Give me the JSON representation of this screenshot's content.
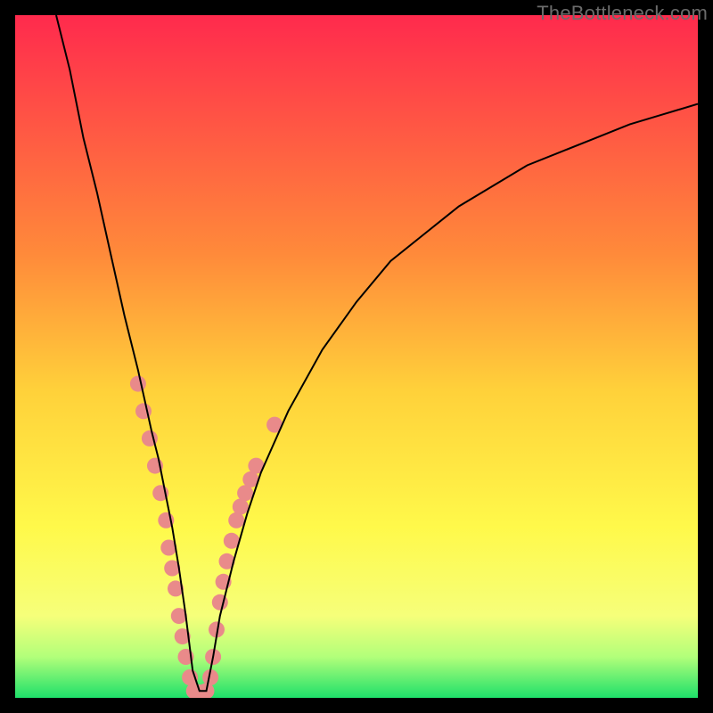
{
  "watermark": "TheBottleneck.com",
  "chart_data": {
    "type": "line",
    "title": "",
    "xlabel": "",
    "ylabel": "",
    "xlim": [
      0,
      100
    ],
    "ylim": [
      0,
      100
    ],
    "grid": false,
    "legend": false,
    "background_gradient": {
      "stops": [
        {
          "offset": 0.0,
          "color": "#ff2a4d"
        },
        {
          "offset": 0.35,
          "color": "#ff8a3a"
        },
        {
          "offset": 0.55,
          "color": "#ffd13a"
        },
        {
          "offset": 0.75,
          "color": "#fff94a"
        },
        {
          "offset": 0.88,
          "color": "#f6ff7a"
        },
        {
          "offset": 0.94,
          "color": "#b2ff7a"
        },
        {
          "offset": 1.0,
          "color": "#1ee06a"
        }
      ]
    },
    "series": [
      {
        "name": "curve",
        "color": "#000000",
        "stroke_width": 2,
        "x": [
          6,
          8,
          10,
          12,
          14,
          16,
          18,
          20,
          21,
          22,
          23,
          24,
          25,
          26,
          27,
          28,
          29,
          30,
          32,
          34,
          36,
          40,
          45,
          50,
          55,
          60,
          65,
          70,
          75,
          80,
          85,
          90,
          95,
          100
        ],
        "y": [
          100,
          92,
          82,
          74,
          65,
          56,
          48,
          39,
          35,
          30,
          25,
          19,
          12,
          4,
          1,
          1,
          6,
          12,
          20,
          27,
          33,
          42,
          51,
          58,
          64,
          68,
          72,
          75,
          78,
          80,
          82,
          84,
          85.5,
          87
        ]
      }
    ],
    "markers": {
      "name": "highlight-points",
      "color": "#e98a8a",
      "radius": 9,
      "points": [
        {
          "x": 18.0,
          "y": 46
        },
        {
          "x": 18.8,
          "y": 42
        },
        {
          "x": 19.7,
          "y": 38
        },
        {
          "x": 20.5,
          "y": 34
        },
        {
          "x": 21.3,
          "y": 30
        },
        {
          "x": 22.1,
          "y": 26
        },
        {
          "x": 22.5,
          "y": 22
        },
        {
          "x": 23.0,
          "y": 19
        },
        {
          "x": 23.5,
          "y": 16
        },
        {
          "x": 24.0,
          "y": 12
        },
        {
          "x": 24.5,
          "y": 9
        },
        {
          "x": 25.0,
          "y": 6
        },
        {
          "x": 25.6,
          "y": 3
        },
        {
          "x": 26.2,
          "y": 1
        },
        {
          "x": 26.8,
          "y": 0.8
        },
        {
          "x": 27.4,
          "y": 0.8
        },
        {
          "x": 28.0,
          "y": 1
        },
        {
          "x": 28.6,
          "y": 3
        },
        {
          "x": 29.0,
          "y": 6
        },
        {
          "x": 29.5,
          "y": 10
        },
        {
          "x": 30.0,
          "y": 14
        },
        {
          "x": 30.5,
          "y": 17
        },
        {
          "x": 31.0,
          "y": 20
        },
        {
          "x": 31.7,
          "y": 23
        },
        {
          "x": 32.4,
          "y": 26
        },
        {
          "x": 33.0,
          "y": 28
        },
        {
          "x": 33.7,
          "y": 30
        },
        {
          "x": 34.5,
          "y": 32
        },
        {
          "x": 35.3,
          "y": 34
        },
        {
          "x": 38.0,
          "y": 40
        }
      ]
    }
  }
}
